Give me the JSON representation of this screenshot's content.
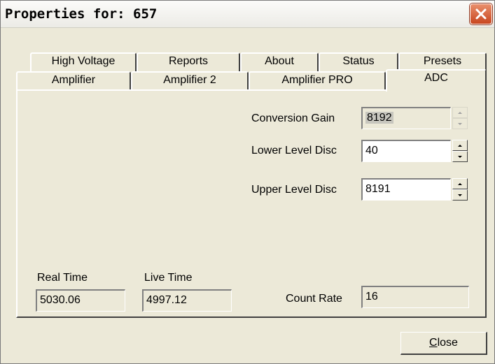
{
  "window": {
    "title": "Properties for: 657",
    "close_icon": "close-icon"
  },
  "tabs": {
    "row1": [
      "High Voltage",
      "Reports",
      "About",
      "Status",
      "Presets"
    ],
    "row2": [
      "Amplifier",
      "Amplifier 2",
      "Amplifier PRO",
      "ADC"
    ],
    "active": "ADC"
  },
  "adc": {
    "conversion_gain_label": "Conversion Gain",
    "conversion_gain_value": "8192",
    "lower_level_disc_label": "Lower Level Disc",
    "lower_level_disc_value": "40",
    "upper_level_disc_label": "Upper Level Disc",
    "upper_level_disc_value": "8191",
    "real_time_label": "Real Time",
    "real_time_value": "5030.06",
    "live_time_label": "Live Time",
    "live_time_value": "4997.12",
    "count_rate_label": "Count Rate",
    "count_rate_value": "16"
  },
  "buttons": {
    "close_label": "Close"
  },
  "colors": {
    "dialog_bg": "#ece9d8",
    "close_button_red": "#c8461f"
  }
}
